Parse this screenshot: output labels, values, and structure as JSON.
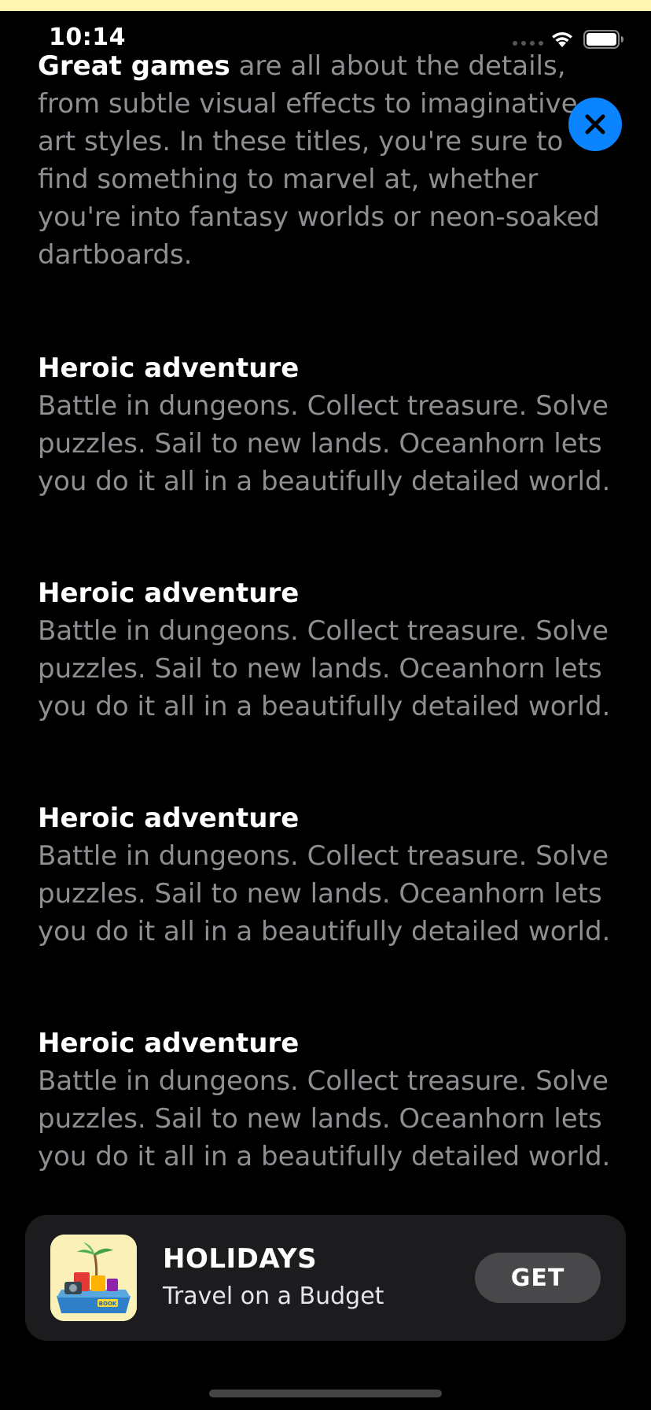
{
  "status_bar": {
    "time": "10:14"
  },
  "intro": {
    "lead": "Great games",
    "rest": " are all about the details, from subtle visual effects to imaginative art styles. In these titles, you're sure to find something to marvel at, whether you're into fantasy worlds or neon-soaked dartboards."
  },
  "sections": [
    {
      "title": "Heroic adventure",
      "body": "Battle in dungeons. Collect treasure. Solve puzzles. Sail to new lands. Oceanhorn lets you do it all in a beautifully detailed world."
    },
    {
      "title": "Heroic adventure",
      "body": "Battle in dungeons. Collect treasure. Solve puzzles. Sail to new lands. Oceanhorn lets you do it all in a beautifully detailed world."
    },
    {
      "title": "Heroic adventure",
      "body": "Battle in dungeons. Collect treasure. Solve puzzles. Sail to new lands. Oceanhorn lets you do it all in a beautifully detailed world."
    },
    {
      "title": "Heroic adventure",
      "body": "Battle in dungeons. Collect treasure. Solve puzzles. Sail to new lands. Oceanhorn lets you do it all in a beautifully detailed world."
    }
  ],
  "app_card": {
    "name": "HOLIDAYS",
    "subtitle": "Travel on a Budget",
    "get_label": "GET",
    "icon_text": "BOOK"
  },
  "icons": {
    "close": "close-icon",
    "wifi": "wifi-icon",
    "battery": "battery-icon"
  },
  "colors": {
    "accent": "#0a84ff",
    "top_strip": "#fdf5b0",
    "body_text": "#8e8e93",
    "card_bg": "#1c1c1e",
    "get_button": "#48484a"
  }
}
